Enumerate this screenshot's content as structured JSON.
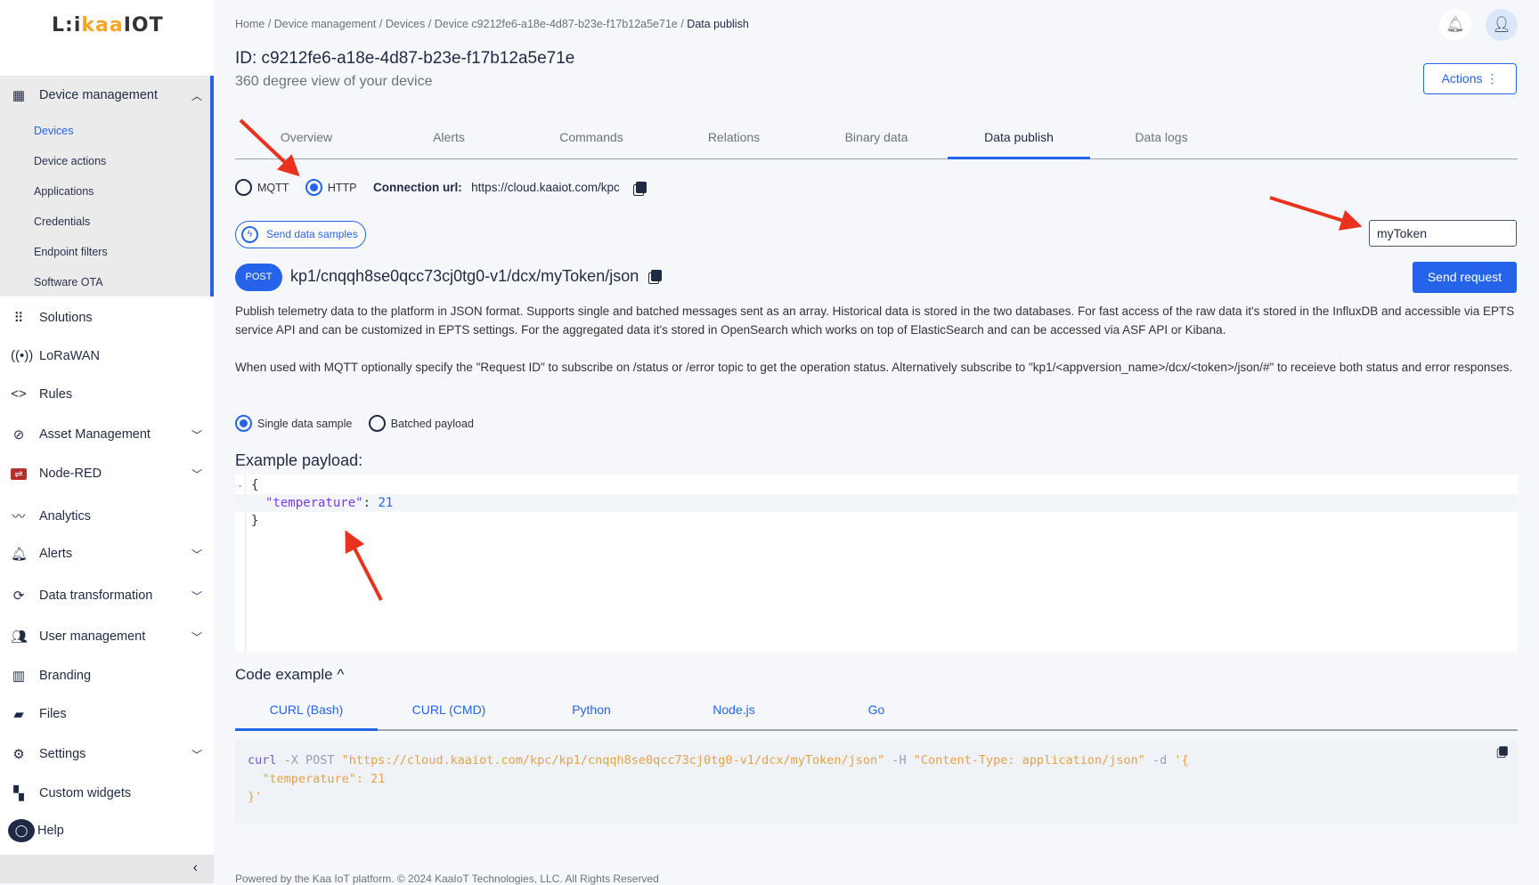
{
  "logo": {
    "prefix": "L:i",
    "brand": "kaa",
    "suffix": "IOT"
  },
  "sidebar": {
    "group": {
      "label": "Device management",
      "icon": "device-icon",
      "expanded": true,
      "items": [
        {
          "label": "Devices",
          "active": true
        },
        {
          "label": "Device actions"
        },
        {
          "label": "Applications"
        },
        {
          "label": "Credentials"
        },
        {
          "label": "Endpoint filters"
        },
        {
          "label": "Software OTA"
        }
      ]
    },
    "items": [
      {
        "label": "Solutions",
        "icon": "grid-icon"
      },
      {
        "label": "LoRaWAN",
        "icon": "antenna-icon"
      },
      {
        "label": "Rules",
        "icon": "code-icon"
      },
      {
        "label": "Asset Management",
        "icon": "asset-icon",
        "chevron": true
      },
      {
        "label": "Node-RED",
        "icon": "node-red-icon",
        "chevron": true
      },
      {
        "label": "Analytics",
        "icon": "analytics-icon"
      },
      {
        "label": "Alerts",
        "icon": "bell-icon",
        "chevron": true
      },
      {
        "label": "Data transformation",
        "icon": "transform-icon",
        "chevron": true
      },
      {
        "label": "User management",
        "icon": "users-icon",
        "chevron": true
      },
      {
        "label": "Branding",
        "icon": "branding-icon"
      },
      {
        "label": "Files",
        "icon": "folder-icon"
      },
      {
        "label": "Settings",
        "icon": "gear-icon",
        "chevron": true
      },
      {
        "label": "Custom widgets",
        "icon": "widgets-icon"
      },
      {
        "label": "Help",
        "icon": "chat-icon"
      }
    ]
  },
  "breadcrumb": [
    "Home",
    "Device management",
    "Devices",
    "Device c9212fe6-a18e-4d87-b23e-f17b12a5e71e",
    "Data publish"
  ],
  "header": {
    "title": "ID: c9212fe6-a18e-4d87-b23e-f17b12a5e71e",
    "subtitle": "360 degree view of your device",
    "actions_label": "Actions ⋮"
  },
  "tabs": [
    {
      "label": "Overview"
    },
    {
      "label": "Alerts"
    },
    {
      "label": "Commands"
    },
    {
      "label": "Relations"
    },
    {
      "label": "Binary data"
    },
    {
      "label": "Data publish",
      "active": true
    },
    {
      "label": "Data logs"
    }
  ],
  "protocol": {
    "options": [
      "MQTT",
      "HTTP"
    ],
    "selected": "HTTP",
    "connection_label": "Connection url:",
    "connection_url": "https://cloud.kaaiot.com/kpc"
  },
  "send_samples_label": "Send data samples",
  "token_value": "myToken",
  "request": {
    "method": "POST",
    "path": "kp1/cnqqh8se0qcc73cj0tg0-v1/dcx/myToken/json",
    "send_label": "Send request"
  },
  "description": [
    "Publish telemetry data to the platform in JSON format. Supports single and batched messages sent as an array. Historical data is stored in the two databases. For fast access of the raw data it's stored in the InfluxDB and accessible via EPTS service API and can be customized in EPTS settings. For the aggregated data it's stored in OpenSearch which works on top of ElasticSearch and can be accessed via ASF API or Kibana.",
    "When used with MQTT optionally specify the \"Request ID\" to subscribe on /status or /error topic to get the operation status. Alternatively subscribe to \"kp1/<appversion_name>/dcx/<token>/json/#\" to receieve both status and error responses."
  ],
  "payload_type": {
    "options": [
      "Single data sample",
      "Batched payload"
    ],
    "selected": "Single data sample"
  },
  "example": {
    "title": "Example payload:",
    "open": "{",
    "key": "\"temperature\"",
    "sep": ": ",
    "value": "21",
    "close": "}"
  },
  "code_example": {
    "title": "Code example ^",
    "tabs": [
      "CURL (Bash)",
      "CURL (CMD)",
      "Python",
      "Node.js",
      "Go"
    ],
    "active": "CURL (Bash)",
    "lines": {
      "cmd": "curl",
      "flag1": " -X POST ",
      "url": "\"https://cloud.kaaiot.com/kpc/kp1/cnqqh8se0qcc73cj0tg0-v1/dcx/myToken/json\"",
      "flag2": " -H ",
      "header": "\"Content-Type: application/json\"",
      "flag3": " -d ",
      "body1": "'{",
      "body2": "  \"temperature\": 21",
      "body3": "}'"
    }
  },
  "footer": "Powered by the Kaa IoT platform. © 2024 KaaIoT Technologies, LLC. All Rights Reserved",
  "colors": {
    "accent": "#2563eb",
    "annotation": "#e8321e",
    "logo_orange": "#f5a623"
  }
}
